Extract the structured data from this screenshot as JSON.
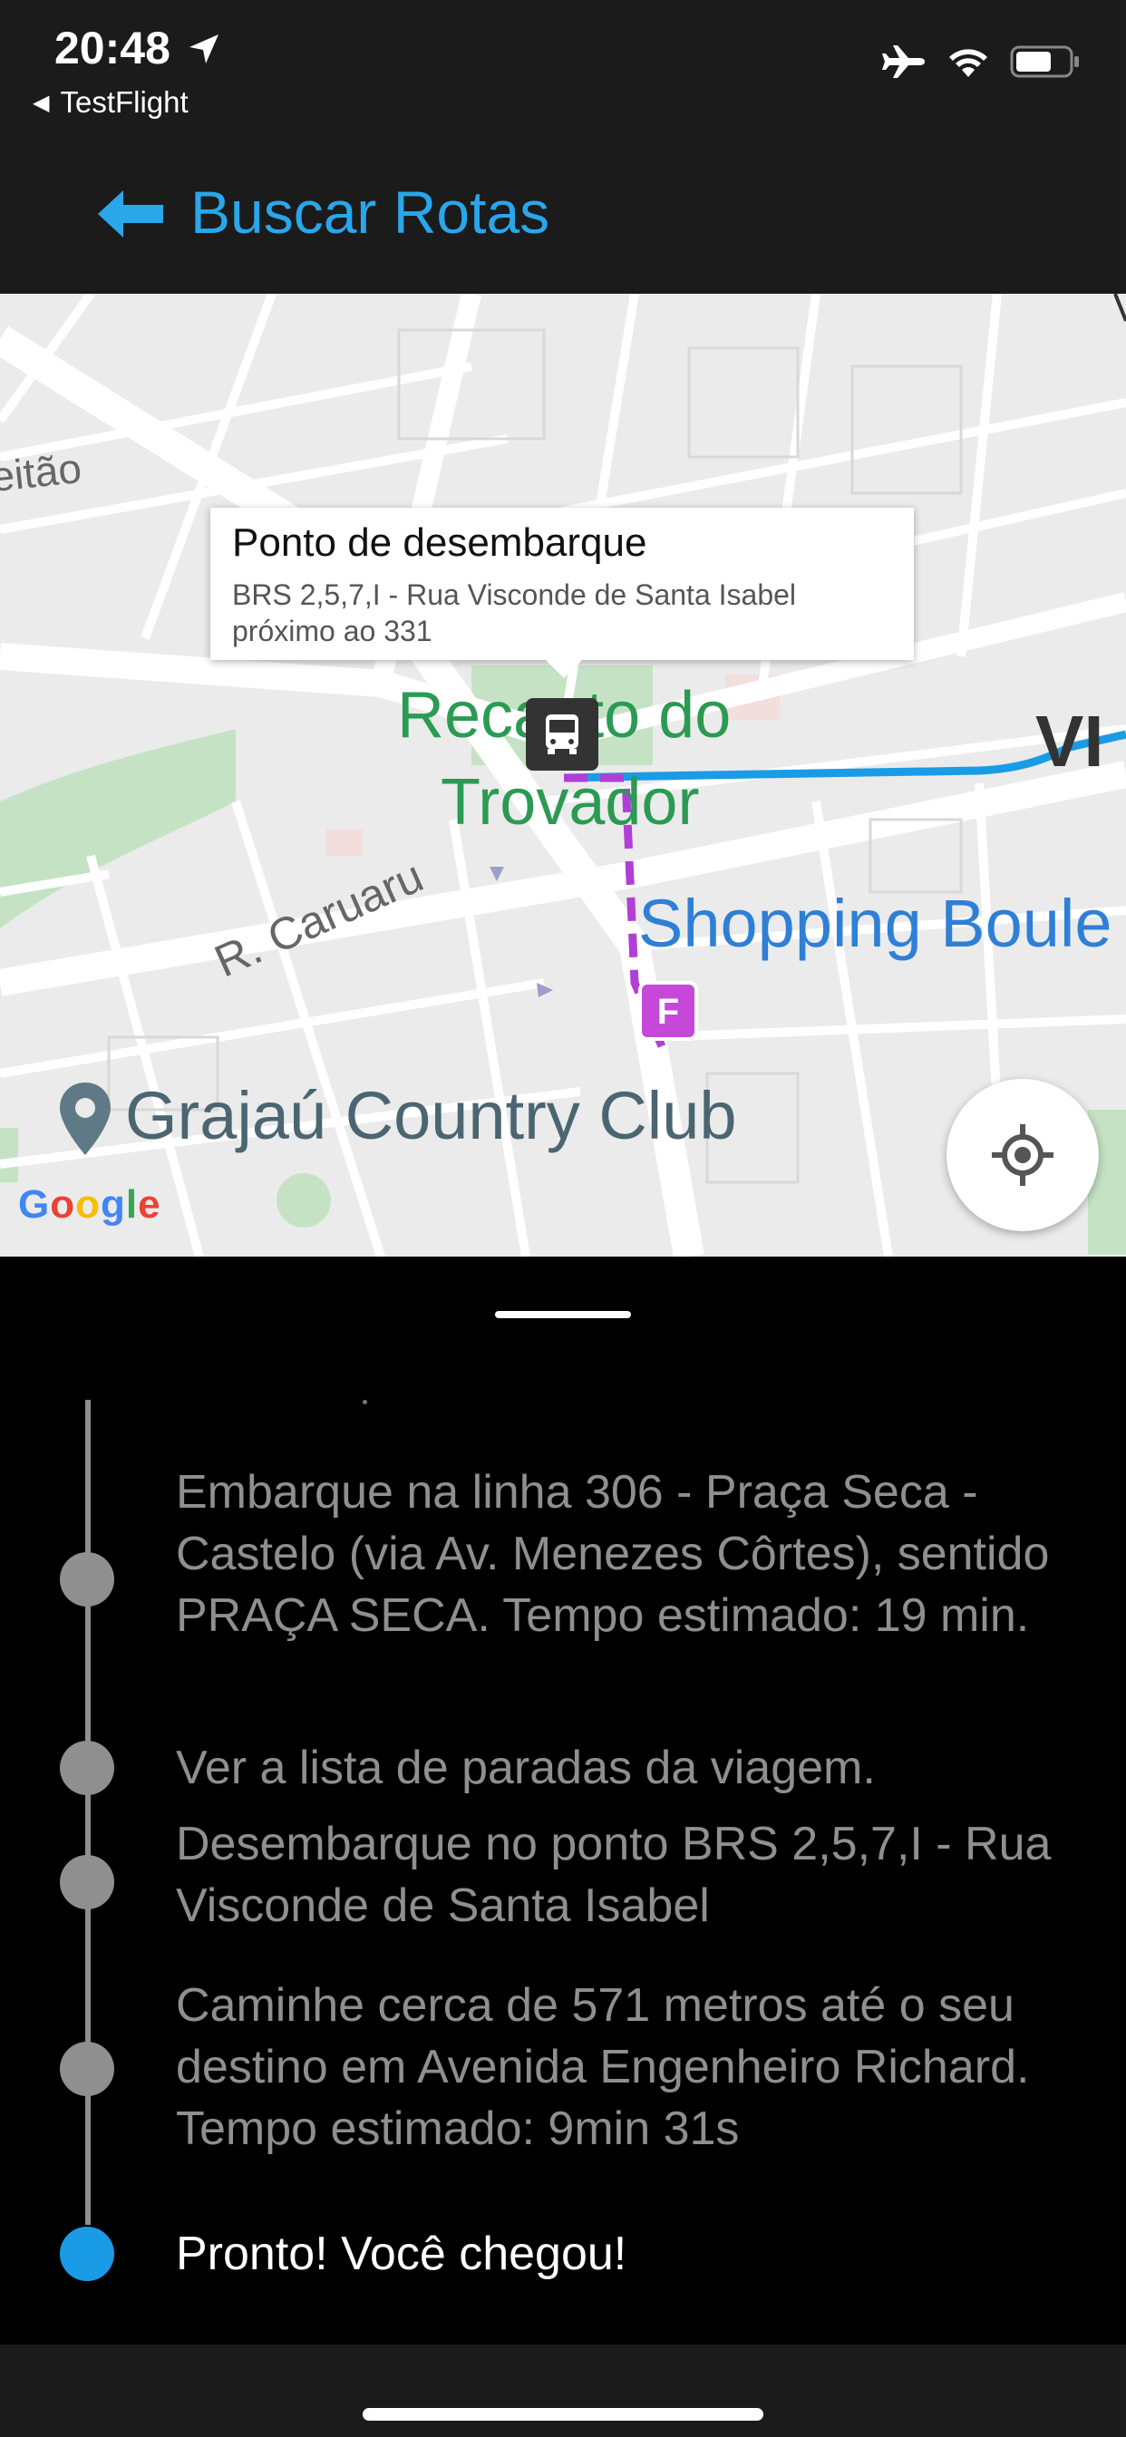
{
  "status_bar": {
    "time": "20:48",
    "back_app": "TestFlight",
    "icons": [
      "location-arrow-icon",
      "airplane-icon",
      "wifi-icon",
      "battery-icon"
    ]
  },
  "nav": {
    "back_icon": "arrow-left-icon",
    "title": "Buscar Rotas",
    "accent_color": "#2aa6ea"
  },
  "map": {
    "callout": {
      "title": "Ponto de desembarque",
      "subtitle": "BRS 2,5,7,I - Rua Visconde de Santa Isabel próximo ao 331"
    },
    "labels": {
      "partial_left": "eitão",
      "recanto": "Recanto do",
      "trovador": "Trovador",
      "shopping": "Shopping Boule",
      "street": "R. Caruaru",
      "club": "Grajaú Country Club",
      "edge_right": "VI"
    },
    "markers": {
      "bus_stop": "bus-icon",
      "finish": "F"
    },
    "route_colors": {
      "bus": "#1a9be6",
      "walk": "#b03fd6"
    },
    "google_logo": "Google"
  },
  "steps": [
    {
      "text": "Embarque na linha 306 - Praça Seca - Castelo (via Av. Menezes Côrtes), sentido PRAÇA SECA. Tempo estimado: 19 min.",
      "active": false
    },
    {
      "text": "Ver a lista de paradas da viagem.",
      "active": false
    },
    {
      "text": "Desembarque no ponto BRS 2,5,7,I - Rua Visconde de Santa Isabel",
      "active": false
    },
    {
      "text": "Caminhe cerca de 571 metros até o seu destino em Avenida Engenheiro Richard. Tempo estimado: 9min 31s",
      "active": false
    },
    {
      "text": "Pronto! Você chegou!",
      "active": true
    }
  ]
}
